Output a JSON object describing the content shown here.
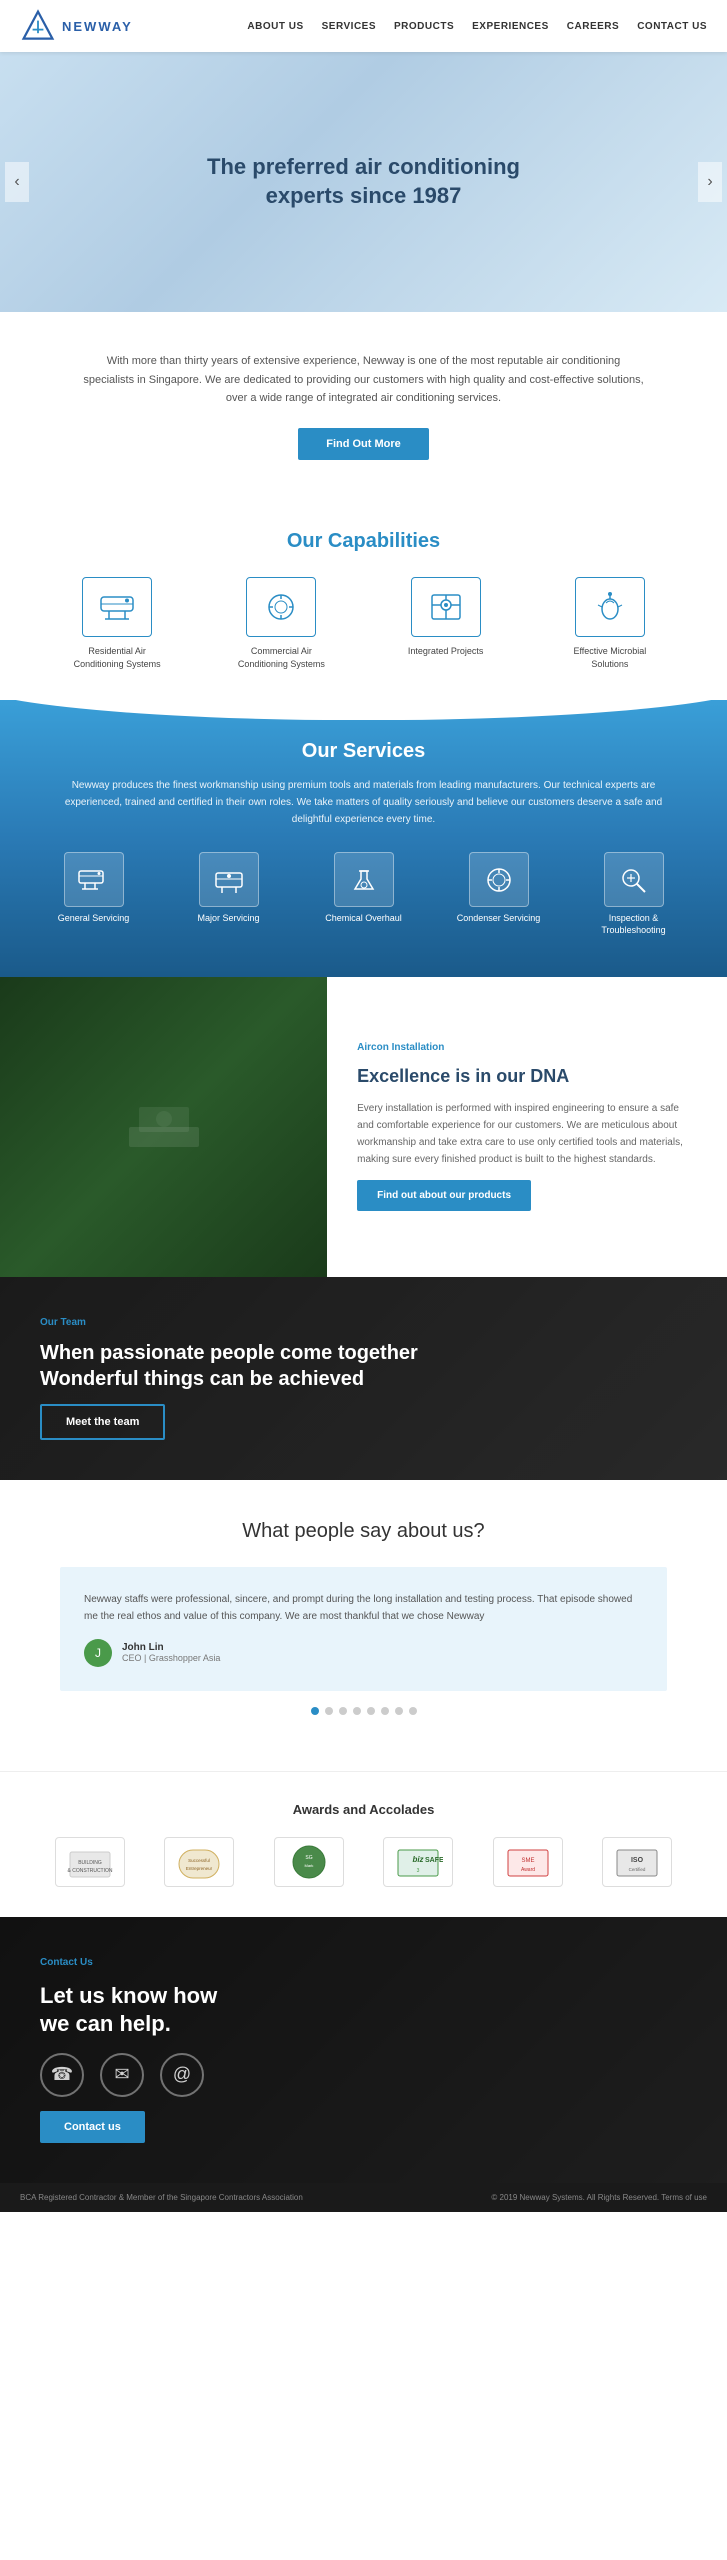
{
  "nav": {
    "logo_text": "NEWWAY",
    "links": [
      "ABOUT US",
      "SERVICES",
      "PRODUCTS",
      "EXPERIENCES",
      "CAREERS",
      "CONTACT US"
    ]
  },
  "hero": {
    "title": "The preferred air conditioning",
    "subtitle": "experts since 1987"
  },
  "about": {
    "description": "With more than thirty years of extensive experience, Newway is one of the most reputable air conditioning specialists in Singapore. We are dedicated to providing our customers with high quality and cost-effective solutions, over a wide range of integrated air conditioning services.",
    "cta_label": "Find Out More"
  },
  "capabilities": {
    "heading": "Our Capabilities",
    "items": [
      {
        "label": "Residential Air\nConditioning Systems",
        "icon": "❄"
      },
      {
        "label": "Commercial Air\nConditioning Systems",
        "icon": "🌀"
      },
      {
        "label": "Integrated Projects",
        "icon": "📊"
      },
      {
        "label": "Effective Microbial\nSolutions",
        "icon": "🧴"
      }
    ]
  },
  "services": {
    "heading": "Our Services",
    "description": "Newway produces the finest workmanship using premium tools and materials from leading manufacturers. Our technical experts are experienced, trained and certified in their own roles. We take matters of quality seriously and believe our customers deserve a safe and delightful experience every time.",
    "items": [
      {
        "label": "General Servicing",
        "icon": "❄"
      },
      {
        "label": "Major Servicing",
        "icon": "🔧"
      },
      {
        "label": "Chemical Overhaul",
        "icon": "⚗"
      },
      {
        "label": "Condenser Servicing",
        "icon": "🌀"
      },
      {
        "label": "Inspection &\nTroubleshooting",
        "icon": "🔍"
      }
    ]
  },
  "aircon": {
    "label": "Aircon Installation",
    "heading": "Excellence is in our DNA",
    "description": "Every installation is performed with inspired engineering to ensure a safe and comfortable experience for our customers. We are meticulous about workmanship and take extra care to use only certified tools and materials, making sure every finished product is built to the highest standards.",
    "cta_label": "Find out about our products"
  },
  "team": {
    "label": "Our Team",
    "heading": "When passionate people come together\nWonderful things can be achieved",
    "cta_label": "Meet the team"
  },
  "testimonials": {
    "heading": "What people say about us?",
    "quote": "Newway staffs were professional, sincere, and prompt during the long installation and testing process. That episode showed me the real ethos and value of this company. We are most thankful that we chose Newway",
    "author_name": "John Lin",
    "author_title": "CEO | Grasshopper Asia",
    "author_initial": "J",
    "dots": [
      true,
      false,
      false,
      false,
      false,
      false,
      false,
      false
    ]
  },
  "awards": {
    "heading": "Awards and Accolades",
    "logos": [
      "Building &\nConstruction",
      "Successful\nEntrepreneur",
      "SG Mark",
      "bizSAFE 3",
      "SME &\nAward",
      "ISO\nCertified"
    ]
  },
  "contact": {
    "label": "Contact Us",
    "heading": "Let us know how\nwe can help.",
    "cta_label": "Contact us",
    "icons": [
      "☎",
      "✉",
      "@"
    ]
  },
  "footer": {
    "left": "BCA Registered Contractor & Member of the Singapore Contractors Association",
    "right": "© 2019 Newway Systems. All Rights Reserved.",
    "link": "Terms of use"
  }
}
